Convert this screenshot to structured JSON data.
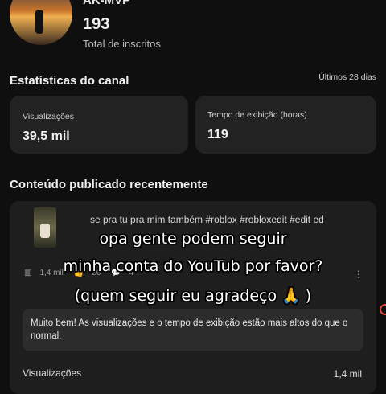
{
  "channel": {
    "name": "AK-MVP",
    "subscriber_count": "193",
    "subscriber_label": "Total de inscritos"
  },
  "stats": {
    "title": "Estatísticas do canal",
    "period": "Últimos 28 dias",
    "views": {
      "label": "Visualizações",
      "value": "39,5 mil"
    },
    "watch_time": {
      "label": "Tempo de exibição (horas)",
      "value": "119"
    }
  },
  "recent": {
    "title": "Conteúdo publicado recentemente",
    "video": {
      "description": "se pra tu pra mim também #roblox #robloxedit #edit ed",
      "views": "1,4 mil",
      "likes": "26",
      "comments": "4"
    },
    "notice": "Muito bem! As visualizações e o tempo de exibição estão mais altos do que o normal.",
    "views_row": {
      "label": "Visualizações",
      "value": "1,4 mil"
    }
  },
  "overlay_caption": {
    "line1": "opa gente podem seguir",
    "line2": "minha conta do YouTub  por favor?",
    "line3": "(quem seguir eu agradeço 🙏 )"
  }
}
